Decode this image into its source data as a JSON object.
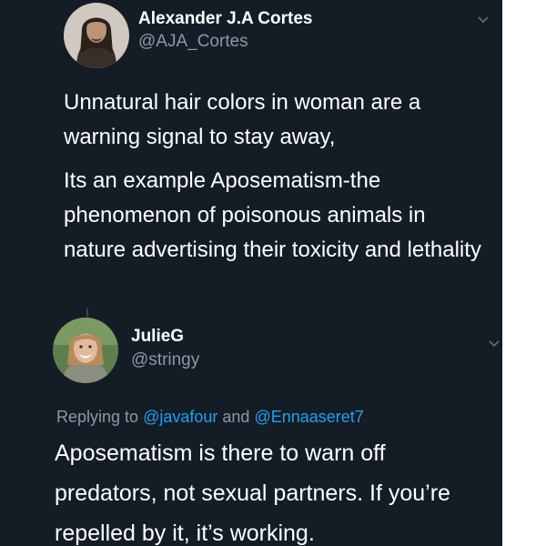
{
  "tweet1": {
    "author_name": "Alexander J.A Cortes",
    "author_handle": "@AJA_Cortes",
    "paragraph1": "Unnatural hair colors in woman are a warning signal to stay away,",
    "paragraph2": "Its an example Aposematism-the phenomenon of poisonous animals in nature advertising their toxicity and lethality",
    "avatar_icon": "avatar-man-long-hair",
    "menu_icon": "chevron-down-icon"
  },
  "tweet2": {
    "author_name": "JulieG",
    "author_handle": "@stringy",
    "replying_prefix": "Replying to",
    "mention1": "@javafour",
    "replying_and": "and",
    "mention2": "@Ennaaseret7",
    "body": "Aposematism is there to warn off predators, not sexual partners. If you’re repelled by it, it’s working.",
    "avatar_icon": "avatar-woman-smiling",
    "menu_icon": "chevron-down-icon"
  },
  "colors": {
    "background": "#141d26",
    "primary_text": "#ffffff",
    "secondary_text": "#8899a6",
    "link": "#1da1f2"
  }
}
